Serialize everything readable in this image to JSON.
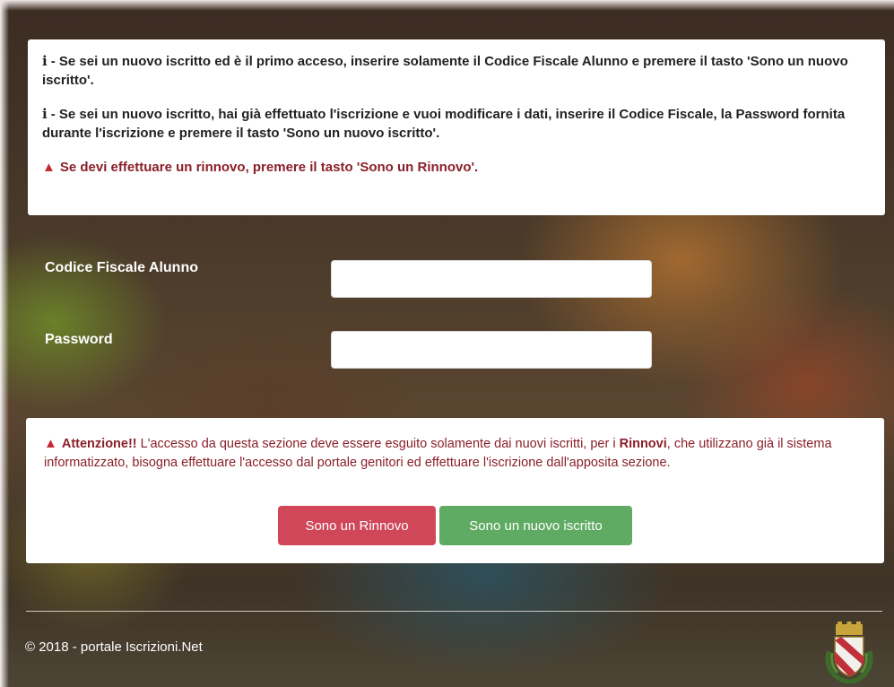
{
  "info": {
    "icon_glyph": "i",
    "line1_text": "- Se sei un nuovo iscritto ed è il primo acceso, inserire solamente il Codice Fiscale Alunno e premere il tasto 'Sono un nuovo iscritto'.",
    "line2_text": "- Se sei un nuovo iscritto, hai già effettuato l'iscrizione e vuoi modificare i dati, inserire il Codice Fiscale, la Password fornita durante l'iscrizione e premere il tasto 'Sono un nuovo iscritto'.",
    "warning_text": "Se devi effettuare un rinnovo, premere il tasto 'Sono un Rinnovo'.",
    "warning_icon": "warning-triangle-icon"
  },
  "form": {
    "codice_label": "Codice Fiscale Alunno",
    "codice_value": "",
    "password_label": "Password",
    "password_value": ""
  },
  "alert": {
    "bold_prefix": "Attenzione!!",
    "text_part1": " L'accesso da questa sezione deve essere esguito solamente dai nuovi iscritti, per i ",
    "bold_rinnovi": "Rinnovi",
    "text_part2": ", che utilizzano già il sistema informatizzato, bisogna effettuare l'accesso dal portale genitori ed effettuare l'iscrizione dall'apposita sezione.",
    "rinnovo_button": "Sono un Rinnovo",
    "nuovo_button": "Sono un nuovo iscritto"
  },
  "footer": {
    "copyright": "© 2018 - portale Iscrizioni.Net",
    "crest_icon": "municipal-crest-icon"
  },
  "colors": {
    "warning_red": "#8a2029",
    "button_red": "#d0475a",
    "button_green": "#5fab63"
  }
}
